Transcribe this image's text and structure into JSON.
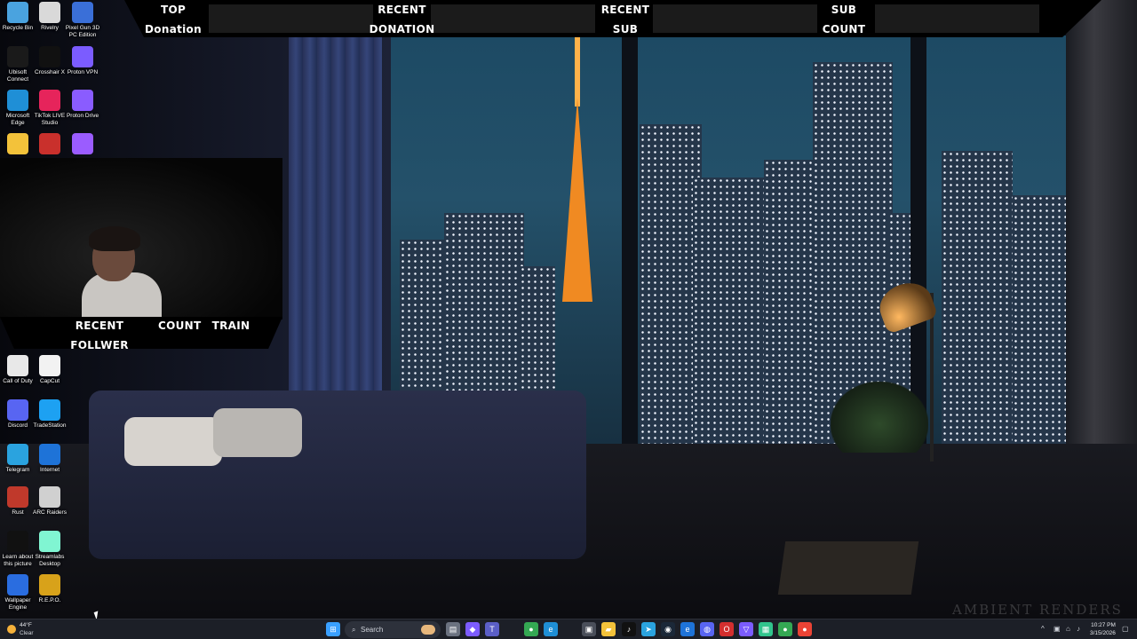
{
  "desktop": {
    "icons_col1": [
      {
        "label": "Recycle Bin",
        "icon": "recycle-bin-icon",
        "color": "#4aa3df"
      },
      {
        "label": "Ubisoft Connect",
        "icon": "ubisoft-icon",
        "color": "#1a1a1a"
      },
      {
        "label": "Microsoft Edge",
        "icon": "edge-icon",
        "color": "#1f8fd6"
      },
      {
        "label": "",
        "icon": "folder-icon",
        "color": "#f3c23a"
      },
      {
        "label": "Call of Duty",
        "icon": "file-icon",
        "color": "#e8e8e8"
      },
      {
        "label": "Discord",
        "icon": "discord-icon",
        "color": "#5865f2"
      },
      {
        "label": "Telegram",
        "icon": "telegram-icon",
        "color": "#2aa3df"
      },
      {
        "label": "Rust",
        "icon": "rust-icon",
        "color": "#c0392b"
      },
      {
        "label": "Learn about this picture",
        "icon": "camera-icon",
        "color": "#111111"
      },
      {
        "label": "Wallpaper Engine",
        "icon": "wallpaper-engine-icon",
        "color": "#2a6de0"
      }
    ],
    "icons_col2": [
      {
        "label": "Rivelry",
        "icon": "rivelry-icon",
        "color": "#d9d9d9"
      },
      {
        "label": "Crosshair X",
        "icon": "crosshair-icon",
        "color": "#111111"
      },
      {
        "label": "TikTok LIVE Studio",
        "icon": "tiktok-icon",
        "color": "#e6245b"
      },
      {
        "label": "",
        "icon": "among-us-icon",
        "color": "#c9302c"
      },
      {
        "label": "CapCut",
        "icon": "capcut-icon",
        "color": "#f2f2f2"
      },
      {
        "label": "TradeStation",
        "icon": "tradestation-icon",
        "color": "#1da1f2"
      },
      {
        "label": "Internet",
        "icon": "internet-explorer-icon",
        "color": "#1e73d8"
      },
      {
        "label": "ARC Raiders",
        "icon": "arc-raiders-icon",
        "color": "#d0d0d0"
      },
      {
        "label": "Streamlabs Desktop",
        "icon": "streamlabs-icon",
        "color": "#80f5d2"
      },
      {
        "label": "R.E.P.O.",
        "icon": "repo-icon",
        "color": "#d8a21a"
      }
    ],
    "icons_col3": [
      {
        "label": "Pixel Gun 3D PC Edition",
        "icon": "pixel-gun-icon",
        "color": "#3a6fd8"
      },
      {
        "label": "Proton VPN",
        "icon": "proton-vpn-icon",
        "color": "#7b5cff"
      },
      {
        "label": "Proton Drive",
        "icon": "proton-drive-icon",
        "color": "#8a5cff"
      },
      {
        "label": "",
        "icon": "app-icon",
        "color": "#9b5cff"
      }
    ],
    "watermark": "AMBIENT RENDERS"
  },
  "overlay": {
    "top_donation_line1": "TOP",
    "top_donation_line2": "Donation",
    "recent_donation_line1": "RECENT",
    "recent_donation_line2": "DONATION",
    "recent_sub_line1": "RECENT",
    "recent_sub_line2": "SUB",
    "sub_count_line1": "SUB",
    "sub_count_line2": "COUNT",
    "recent_follower": "RECENT FOLLWER",
    "count": "COUNT",
    "train": "TRAIN"
  },
  "taskbar": {
    "weather_temp": "44°F",
    "weather_desc": "Clear",
    "search_placeholder": "Search",
    "apps": [
      {
        "icon": "windows-start-icon",
        "color": "#3aa0ff",
        "glyph": "⊞"
      },
      {
        "icon": "file-manager-icon",
        "color": "#6b7280",
        "glyph": "▤"
      },
      {
        "icon": "copilot-icon",
        "color": "#7c5cff",
        "glyph": "◆"
      },
      {
        "icon": "teams-icon",
        "color": "#5b5fc7",
        "glyph": "T"
      },
      {
        "icon": "chrome-icon",
        "color": "#34a853",
        "glyph": "●"
      },
      {
        "icon": "edge-icon",
        "color": "#1f8fd6",
        "glyph": "e"
      },
      {
        "icon": "store-icon",
        "color": "#4a4f5a",
        "glyph": "▣"
      },
      {
        "icon": "folder-icon",
        "color": "#f3c23a",
        "glyph": "▰"
      },
      {
        "icon": "tiktok-icon",
        "color": "#111111",
        "glyph": "♪"
      },
      {
        "icon": "telegram-icon",
        "color": "#2aa3df",
        "glyph": "➤"
      },
      {
        "icon": "steam-icon",
        "color": "#1b2838",
        "glyph": "◉"
      },
      {
        "icon": "internet-explorer-icon",
        "color": "#1e73d8",
        "glyph": "e"
      },
      {
        "icon": "discord-icon",
        "color": "#5865f2",
        "glyph": "◍"
      },
      {
        "icon": "opera-icon",
        "color": "#d32f2f",
        "glyph": "O"
      },
      {
        "icon": "proton-vpn-icon",
        "color": "#7b5cff",
        "glyph": "▽"
      },
      {
        "icon": "streamlabs-icon",
        "color": "#31c48d",
        "glyph": "▦"
      },
      {
        "icon": "chrome-icon-2",
        "color": "#34a853",
        "glyph": "●"
      },
      {
        "icon": "chrome-icon-3",
        "color": "#ea4335",
        "glyph": "●"
      }
    ],
    "time": "10:27 PM",
    "date": "3/15/2026"
  }
}
